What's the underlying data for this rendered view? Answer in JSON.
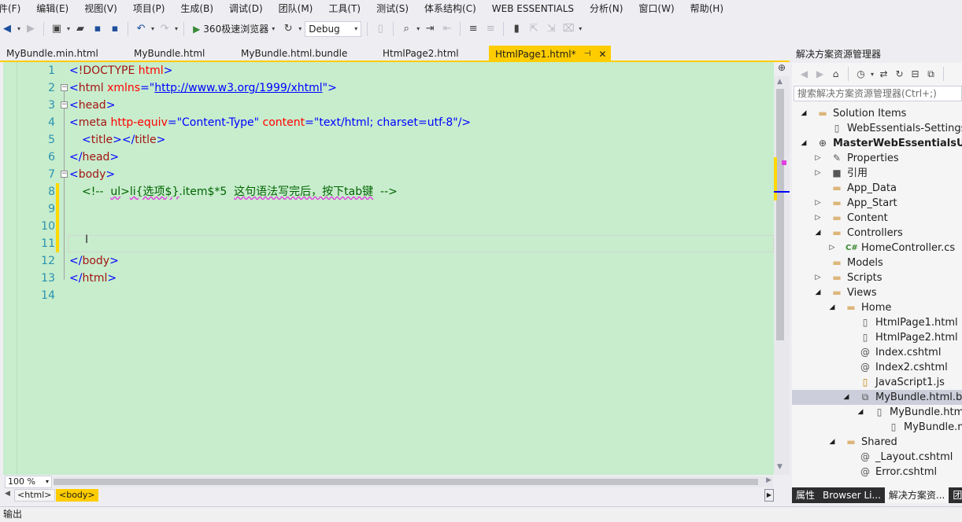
{
  "menu": [
    "件(F)",
    "编辑(E)",
    "视图(V)",
    "项目(P)",
    "生成(B)",
    "调试(D)",
    "团队(M)",
    "工具(T)",
    "测试(S)",
    "体系结构(C)",
    "WEB ESSENTIALS",
    "分析(N)",
    "窗口(W)",
    "帮助(H)"
  ],
  "toolbar": {
    "run_label": "360极速浏览器",
    "config_value": "Debug"
  },
  "tabs": [
    {
      "label": "MyBundle.min.html",
      "active": false
    },
    {
      "label": "MyBundle.html",
      "active": false
    },
    {
      "label": "MyBundle.html.bundle",
      "active": false
    },
    {
      "label": "HtmlPage2.html",
      "active": false
    },
    {
      "label": "HtmlPage1.html*",
      "active": true
    }
  ],
  "editor": {
    "line_numbers": [
      "1",
      "2",
      "3",
      "4",
      "5",
      "6",
      "7",
      "8",
      "9",
      "10",
      "11",
      "12",
      "13",
      "14"
    ],
    "code": {
      "l1": {
        "open": "<",
        "tag": "!DOCTYPE",
        "space": " ",
        "attr": "html",
        "close": ">"
      },
      "l2": {
        "open": "<",
        "tag": "html",
        "sp": " ",
        "attr": "xmlns",
        "eq": "=\"",
        "val": "http://www.w3.org/1999/xhtml",
        "q": "\"",
        "close": ">"
      },
      "l3": {
        "open": "<",
        "tag": "head",
        "close": ">"
      },
      "l4": {
        "open": "<",
        "tag": "meta",
        "sp1": " ",
        "a1": "http-equiv",
        "eq1": "=\"",
        "v1": "Content-Type",
        "q1": "\"",
        "sp2": " ",
        "a2": "content",
        "eq2": "=\"",
        "v2": "text/html; charset=utf-8",
        "q2": "\"",
        "close": "/>"
      },
      "l5": {
        "open1": "<",
        "tag1": "title",
        "close1": "></",
        "tag2": "title",
        "close2": ">"
      },
      "l6": {
        "open": "</",
        "tag": "head",
        "close": ">"
      },
      "l7": {
        "open": "<",
        "tag": "body",
        "close": ">"
      },
      "l8": {
        "c1": "<!--  ",
        "c2": "ul",
        "c3": ">",
        "c4": "li",
        "c5": "{选项$}",
        "c6": ".item$*5  ",
        "c7": "这句语法写完后，按下tab键",
        "c8": "  -->"
      },
      "l12": {
        "open": "</",
        "tag": "body",
        "close": ">"
      },
      "l13": {
        "open": "</",
        "tag": "html",
        "close": ">"
      }
    }
  },
  "zoom": "100 %",
  "breadcrumbs": [
    "<html>",
    "<body>"
  ],
  "status_text": "输出",
  "solution_explorer": {
    "title": "解决方案资源管理器",
    "search_placeholder": "搜索解决方案资源管理器(Ctrl+;)",
    "nodes": [
      {
        "label": "Solution Items",
        "icon": "folder-icon",
        "bold": false
      },
      {
        "label": "WebEssentials-Settings.js",
        "icon": "file-icon",
        "bold": false
      },
      {
        "label": "MasterWebEssentialsUsage",
        "icon": "project-icon",
        "bold": true
      },
      {
        "label": "Properties",
        "icon": "wrench-icon",
        "bold": false
      },
      {
        "label": "引用",
        "icon": "references-icon",
        "bold": false
      },
      {
        "label": "App_Data",
        "icon": "folder-icon",
        "bold": false
      },
      {
        "label": "App_Start",
        "icon": "folder-icon",
        "bold": false
      },
      {
        "label": "Content",
        "icon": "folder-icon",
        "bold": false
      },
      {
        "label": "Controllers",
        "icon": "folder-icon",
        "bold": false
      },
      {
        "label": "HomeController.cs",
        "icon": "csharp-icon",
        "bold": false
      },
      {
        "label": "Models",
        "icon": "folder-icon",
        "bold": false
      },
      {
        "label": "Scripts",
        "icon": "folder-icon",
        "bold": false
      },
      {
        "label": "Views",
        "icon": "folder-icon",
        "bold": false
      },
      {
        "label": "Home",
        "icon": "folder-icon",
        "bold": false
      },
      {
        "label": "HtmlPage1.html",
        "icon": "html-file-icon",
        "bold": false
      },
      {
        "label": "HtmlPage2.html",
        "icon": "html-file-icon",
        "bold": false
      },
      {
        "label": "Index.cshtml",
        "icon": "razor-file-icon",
        "bold": false
      },
      {
        "label": "Index2.cshtml",
        "icon": "razor-file-icon",
        "bold": false
      },
      {
        "label": "JavaScript1.js",
        "icon": "js-file-icon",
        "bold": false
      },
      {
        "label": "MyBundle.html.bun",
        "icon": "bundle-icon",
        "bold": false
      },
      {
        "label": "MyBundle.html",
        "icon": "html-file-icon",
        "bold": false
      },
      {
        "label": "MyBundle.mi",
        "icon": "html-file-icon",
        "bold": false
      },
      {
        "label": "Shared",
        "icon": "folder-icon",
        "bold": false
      },
      {
        "label": "_Layout.cshtml",
        "icon": "razor-file-icon",
        "bold": false
      },
      {
        "label": "Error.cshtml",
        "icon": "razor-file-icon",
        "bold": false
      }
    ],
    "bottom_tabs": [
      "属性",
      "Browser Li...",
      "解决方案资...",
      "团"
    ]
  }
}
